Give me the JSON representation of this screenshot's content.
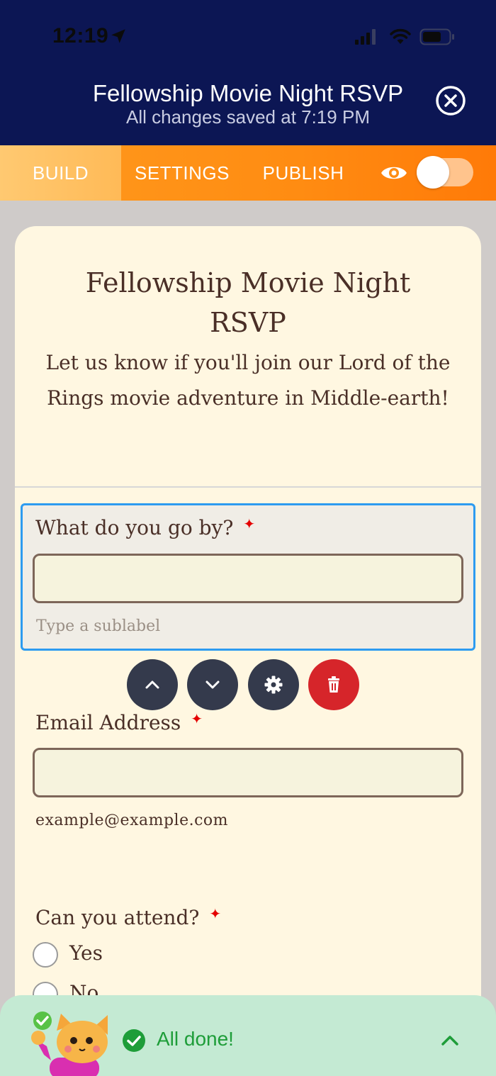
{
  "status_bar": {
    "time": "12:19"
  },
  "header": {
    "title": "Fellowship Movie Night RSVP",
    "subtitle": "All changes saved at 7:19 PM"
  },
  "tabs": [
    {
      "label": "BUILD",
      "active": true
    },
    {
      "label": "SETTINGS",
      "active": false
    },
    {
      "label": "PUBLISH",
      "active": false
    }
  ],
  "preview_toggle": {
    "on": false
  },
  "form": {
    "title": "Fellowship Movie Night RSVP",
    "description": "Let us know if you'll join our Lord of the Rings movie adventure in Middle-earth!",
    "fields": [
      {
        "label": "What do you go by?",
        "required_mark": "✦",
        "value": "",
        "sublabel": "Type a sublabel"
      },
      {
        "label": "Email Address",
        "required_mark": "✦",
        "value": "",
        "helper": "example@example.com"
      },
      {
        "label": "Can you attend?",
        "required_mark": "✦",
        "options": [
          "Yes",
          "No"
        ]
      }
    ]
  },
  "field_controls": [
    "chevron-up-icon",
    "chevron-down-icon",
    "gear-icon",
    "trash-icon"
  ],
  "bottom_bar": {
    "text": "All done!"
  },
  "colors": {
    "header_bg": "#0c1654",
    "tab_bar": "#ff8c12",
    "card_bg": "#fff7e1",
    "selection_border": "#2d9bf0",
    "delete": "#d6252a",
    "success": "#1e9d39"
  }
}
